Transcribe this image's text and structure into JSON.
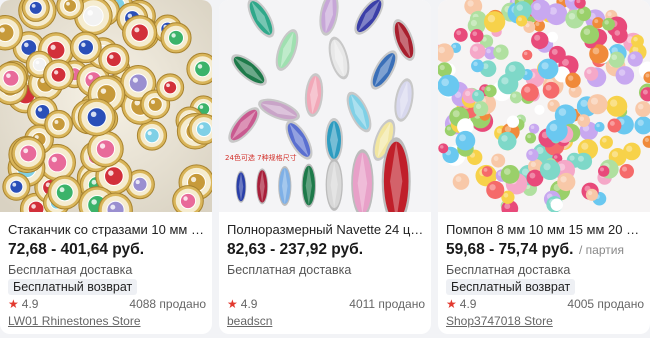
{
  "products": [
    {
      "title": "Стаканчик со стразами 10 мм см...",
      "price": "72,68 - 401,64 руб.",
      "delivery": "Бесплатная доставка",
      "badge": "Бесплатный возврат",
      "rating": "4.9",
      "sold": "4088 продано",
      "store": "LW01 Rhinestones Store"
    },
    {
      "title": "Полноразмерный Navette 24 цве...",
      "price": "82,63 - 237,92 руб.",
      "delivery": "Бесплатная доставка",
      "rating": "4.9",
      "sold": "4011 продано",
      "store": "beadscn",
      "image_caption": "24色可选 7种规格尺寸"
    },
    {
      "title": "Помпон 8 мм 10 мм 15 мм 20 мм ...",
      "price": "59,68 - 75,74 руб.",
      "unit": "/ партия",
      "delivery": "Бесплатная доставка",
      "badge": "Бесплатный возврат",
      "rating": "4.9",
      "sold": "4005 продано",
      "store": "Shop3747018 Store"
    }
  ],
  "icons": {
    "rating": "star-icon"
  },
  "colors": {
    "star": "#e2392f",
    "card_bg": "#ffffff",
    "page_bg": "#f2f3f6"
  }
}
